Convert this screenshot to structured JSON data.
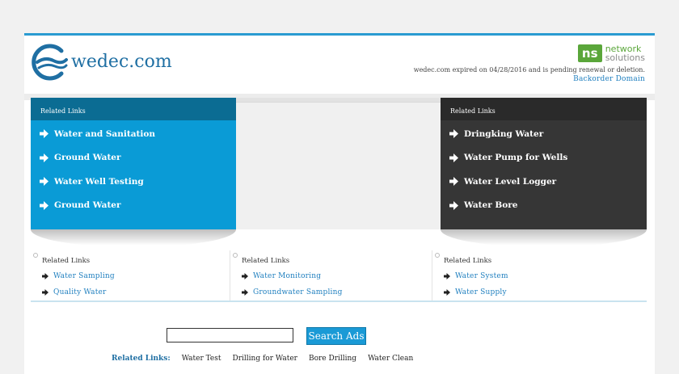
{
  "header": {
    "site_name": "wedec.com",
    "ns_logo_mark": "ns",
    "ns_logo_line1": "network",
    "ns_logo_line2": "solutions",
    "expired_text": "wedec.com expired on 04/28/2016 and is pending renewal or deletion.",
    "backorder_label": "Backorder Domain"
  },
  "left_box": {
    "heading": "Related Links",
    "items": [
      {
        "label": "Water and Sanitation"
      },
      {
        "label": "Ground Water"
      },
      {
        "label": "Water Well Testing"
      },
      {
        "label": "Ground Water"
      }
    ]
  },
  "right_box": {
    "heading": "Related Links",
    "items": [
      {
        "label": "Dringking Water"
      },
      {
        "label": "Water Pump for Wells"
      },
      {
        "label": "Water Level Logger"
      },
      {
        "label": "Water Bore"
      }
    ]
  },
  "lower_related": [
    {
      "heading": "Related Links",
      "items": [
        {
          "label": "Water Sampling"
        },
        {
          "label": "Quality Water"
        }
      ]
    },
    {
      "heading": "Related Links",
      "items": [
        {
          "label": "Water Monitoring"
        },
        {
          "label": "Groundwater Sampling"
        }
      ]
    },
    {
      "heading": "Related Links",
      "items": [
        {
          "label": "Water System"
        },
        {
          "label": "Water Supply"
        }
      ]
    }
  ],
  "search": {
    "value": "",
    "button_label": "Search Ads"
  },
  "bottom_links": {
    "label": "Related Links:",
    "items": [
      {
        "label": "Water Test"
      },
      {
        "label": "Drilling for Water"
      },
      {
        "label": "Bore Drilling"
      },
      {
        "label": "Water Clean"
      }
    ]
  },
  "colors": {
    "accent_blue": "#0a9bd6",
    "dark_box": "#363636",
    "link_blue": "#1f7fbf",
    "ns_green": "#5aa63a"
  },
  "icons": [
    "wedec-logo-icon",
    "arrow-right-icon",
    "small-arrow-icon",
    "circle-bullet-icon"
  ]
}
